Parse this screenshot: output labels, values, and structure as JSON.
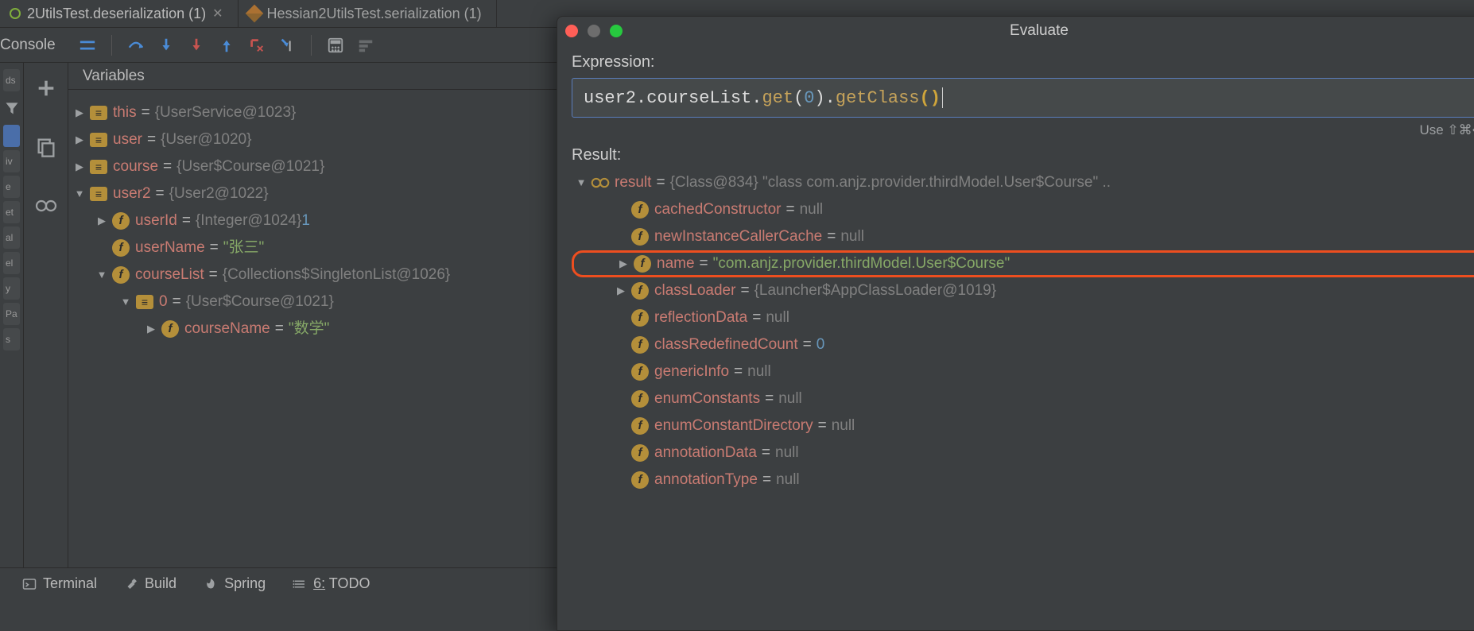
{
  "tabs": [
    {
      "label": "2UtilsTest.deserialization (1)"
    },
    {
      "label": "Hessian2UtilsTest.serialization (1)"
    }
  ],
  "debug_toolbar": {
    "console_label": "Console"
  },
  "left_stripe_items": [
    "ds",
    "",
    "",
    "iv",
    "e",
    "et",
    "al",
    "el",
    "y",
    "Pa",
    "s"
  ],
  "variables": {
    "header": "Variables",
    "tree": [
      {
        "indent": 0,
        "arrow": "right",
        "icon": "equals",
        "name": "this",
        "value": "{UserService@1023}",
        "vtype": "obj"
      },
      {
        "indent": 0,
        "arrow": "right",
        "icon": "equals",
        "name": "user",
        "value": "{User@1020}",
        "vtype": "obj"
      },
      {
        "indent": 0,
        "arrow": "right",
        "icon": "equals",
        "name": "course",
        "value": "{User$Course@1021}",
        "vtype": "obj"
      },
      {
        "indent": 0,
        "arrow": "down",
        "icon": "equals",
        "name": "user2",
        "value": "{User2@1022}",
        "vtype": "obj"
      },
      {
        "indent": 1,
        "arrow": "right",
        "icon": "field",
        "name": "userId",
        "value": "{Integer@1024} ",
        "vtype": "obj",
        "suffix_num": "1"
      },
      {
        "indent": 1,
        "arrow": "none",
        "icon": "field",
        "name": "userName",
        "value": "\"张三\"",
        "vtype": "str"
      },
      {
        "indent": 1,
        "arrow": "down",
        "icon": "field",
        "name": "courseList",
        "value": "{Collections$SingletonList@1026}",
        "vtype": "obj"
      },
      {
        "indent": 2,
        "arrow": "down",
        "icon": "equals",
        "name": "0",
        "value": "{User$Course@1021}",
        "vtype": "obj"
      },
      {
        "indent": 3,
        "arrow": "right",
        "icon": "field",
        "name": "courseName",
        "value": "\"数学\"",
        "vtype": "str"
      }
    ]
  },
  "bottom_bar": {
    "terminal": "Terminal",
    "build": "Build",
    "spring": "Spring",
    "todo": "TODO",
    "todo_prefix": "6:"
  },
  "dialog": {
    "title": "Evaluate",
    "expression_label": "Expression:",
    "expression": {
      "p1": "user2",
      "p2": "courseList",
      "c1": "get",
      "arg": "0",
      "c2": "getClass"
    },
    "hint": "Use ⇧⌘↩ to a",
    "result_label": "Result:",
    "result": [
      {
        "indent": 0,
        "arrow": "down",
        "icon": "glasses",
        "name": "result",
        "value": "{Class@834} \"class com.anjz.provider.thirdModel.User$Course\" ..",
        "vtype": "obj",
        "highlight": false
      },
      {
        "indent": 1,
        "arrow": "none",
        "icon": "field",
        "name": "cachedConstructor",
        "value": "null",
        "vtype": "obj"
      },
      {
        "indent": 1,
        "arrow": "none",
        "icon": "field",
        "name": "newInstanceCallerCache",
        "value": "null",
        "vtype": "obj"
      },
      {
        "indent": 1,
        "arrow": "right",
        "icon": "field",
        "name": "name",
        "value": "\"com.anjz.provider.thirdModel.User$Course\"",
        "vtype": "str",
        "highlight": true
      },
      {
        "indent": 1,
        "arrow": "right",
        "icon": "field",
        "name": "classLoader",
        "value": "{Launcher$AppClassLoader@1019}",
        "vtype": "obj"
      },
      {
        "indent": 1,
        "arrow": "none",
        "icon": "field",
        "name": "reflectionData",
        "value": "null",
        "vtype": "obj"
      },
      {
        "indent": 1,
        "arrow": "none",
        "icon": "field",
        "name": "classRedefinedCount",
        "value": "0",
        "vtype": "num"
      },
      {
        "indent": 1,
        "arrow": "none",
        "icon": "field",
        "name": "genericInfo",
        "value": "null",
        "vtype": "obj"
      },
      {
        "indent": 1,
        "arrow": "none",
        "icon": "field",
        "name": "enumConstants",
        "value": "null",
        "vtype": "obj"
      },
      {
        "indent": 1,
        "arrow": "none",
        "icon": "field",
        "name": "enumConstantDirectory",
        "value": "null",
        "vtype": "obj"
      },
      {
        "indent": 1,
        "arrow": "none",
        "icon": "field",
        "name": "annotationData",
        "value": "null",
        "vtype": "obj"
      },
      {
        "indent": 1,
        "arrow": "none",
        "icon": "field",
        "name": "annotationType",
        "value": "null",
        "vtype": "obj"
      }
    ]
  }
}
